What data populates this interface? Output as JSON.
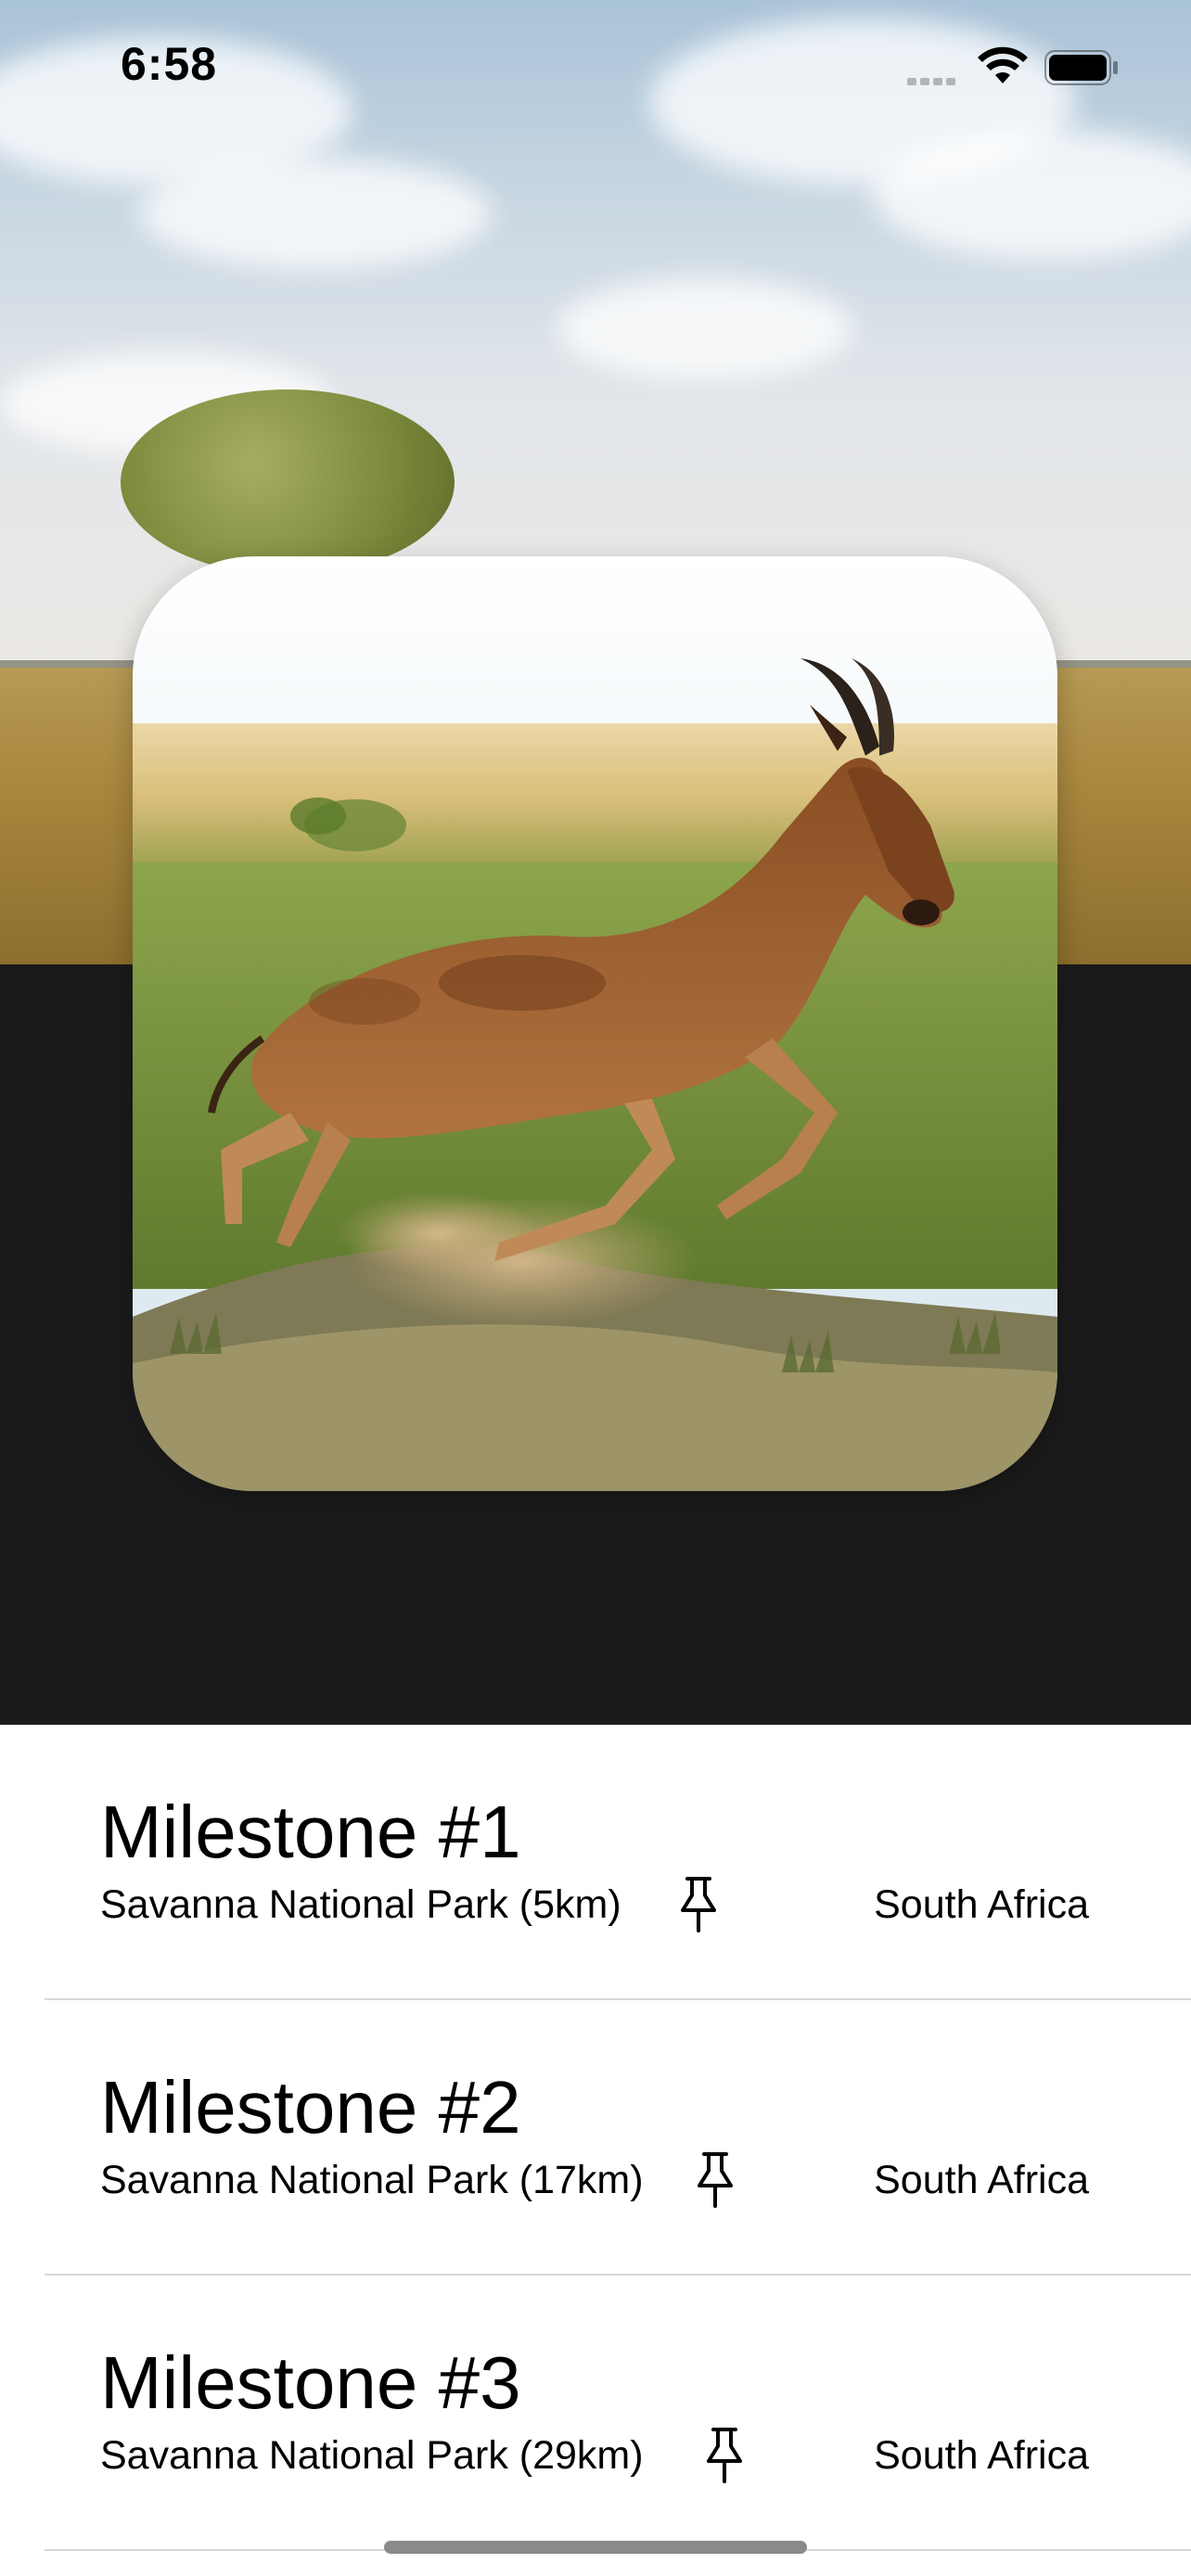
{
  "status_bar": {
    "time": "6:58",
    "signal_icon": "cellular-signal-icon",
    "wifi_icon": "wifi-icon",
    "battery_icon": "battery-full-icon"
  },
  "hero": {
    "background_image": "savanna-landscape-with-tree",
    "featured_image": "antelope-running-on-savanna"
  },
  "milestones": [
    {
      "title": "Milestone #1",
      "location": "Savanna National Park (5km)",
      "country": "South Africa",
      "icon": "pin-icon"
    },
    {
      "title": "Milestone #2",
      "location": "Savanna National Park (17km)",
      "country": "South Africa",
      "icon": "pin-icon"
    },
    {
      "title": "Milestone #3",
      "location": "Savanna National Park (29km)",
      "country": "South Africa",
      "icon": "pin-icon"
    }
  ],
  "colors": {
    "hero_dark": "#1b1b1b",
    "list_background": "#ffffff",
    "text": "#000000",
    "divider": "#d8d8d8"
  }
}
